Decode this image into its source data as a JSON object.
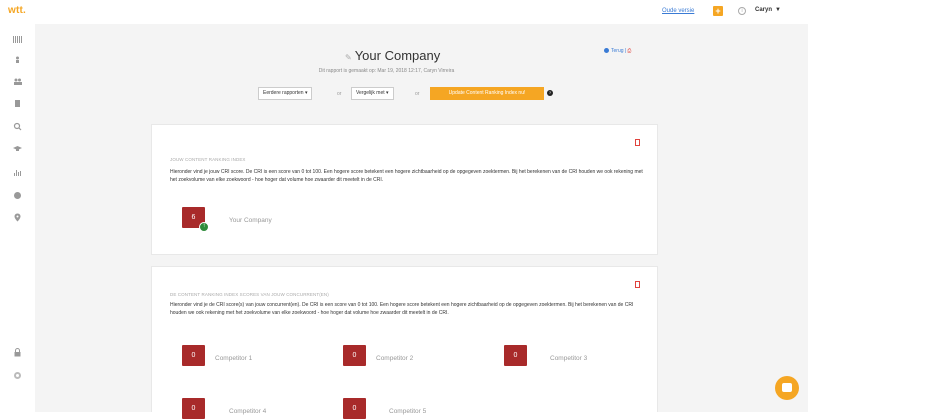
{
  "brand": {
    "logo": "wtt."
  },
  "topbar": {
    "old_version_link": "Oude versie",
    "plus_label": "+",
    "info_icon": "i",
    "user_name": "Caryn",
    "user_caret": "▼"
  },
  "sidebar": {
    "icons": [
      "barcode-icon",
      "user-icon",
      "users-icon",
      "document-icon",
      "search-icon",
      "graduation-icon",
      "bar-chart-icon",
      "pie-chart-icon",
      "map-pin-icon",
      "lock-icon",
      "settings-circle-icon"
    ]
  },
  "header": {
    "title": "Your Company",
    "subtitle": "Dit rapport is gemaakt op: Mar 19, 2018 12:17, Caryn Virreira",
    "back_link": "Terug",
    "back_sep": "|"
  },
  "controls": {
    "earlier_reports": "Eerdere rapporten ▾",
    "or1": "or",
    "compare": "Vergelijk met ▾",
    "or2": "or",
    "update_button": "Update Content Ranking Index nu!",
    "help": "?"
  },
  "own_index": {
    "heading": "JOUW CONTENT RANKING INDEX",
    "description": "Hieronder vind je jouw CRI score. De CRI is een score van 0 tot 100. Een hogere score betekent een hogere zichtbaarheid op de opgegeven zoektermen. Bij het berekenen van de CRI houden we ook rekening met het zoekvolume van elke zoekwoord - hoe hoger dat volume hoe zwaarder dit meetelt in de CRI.",
    "score": "6",
    "company": "Your Company",
    "trend": "↑"
  },
  "competitors": {
    "heading": "DE CONTENT RANKING INDEX SCORES VAN JOUW CONCURRENT(EN)",
    "description": "Hieronder vind je de CRI score(s) van jouw concurrent(en). De CRI is een score van 0 tot 100. Een hogere score betekent een hogere zichtbaarheid op de opgegeven zoektermen. Bij het berekenen van de CRI houden we ook rekening met het zoekvolume van elke zoekwoord - hoe hoger dat volume hoe zwaarder dit meetelt in de CRI.",
    "items": [
      {
        "score": "0",
        "name": "Competitor 1"
      },
      {
        "score": "0",
        "name": "Competitor 2"
      },
      {
        "score": "0",
        "name": "Competitor 3"
      },
      {
        "score": "0",
        "name": "Competitor 4"
      },
      {
        "score": "0",
        "name": "Competitor 5"
      }
    ]
  },
  "colors": {
    "accent": "#f5a623",
    "score_bg": "#a82a2a",
    "link": "#3a7bd5",
    "pdf": "#e0433d",
    "positive": "#2e8b3a"
  }
}
